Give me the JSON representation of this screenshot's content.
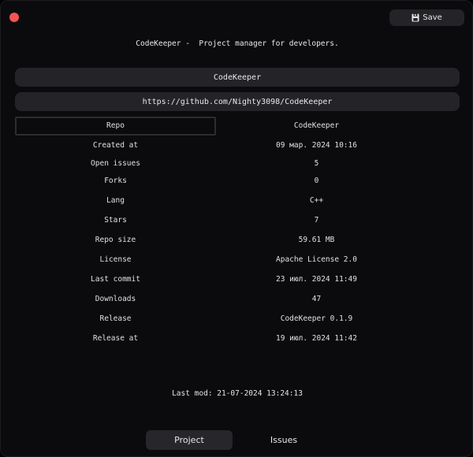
{
  "window": {
    "title": "CodeKeeper -  Project manager for developers.",
    "save_label": "Save"
  },
  "project": {
    "name": "CodeKeeper",
    "url": "https://github.com/Nighty3098/CodeKeeper"
  },
  "table": {
    "rows": [
      {
        "label": "Repo",
        "value": "CodeKeeper"
      },
      {
        "label": "Created at",
        "value": "09 мар. 2024 10:16"
      },
      {
        "label": "Open issues",
        "value": "5"
      },
      {
        "label": "Forks",
        "value": "0"
      },
      {
        "label": "Lang",
        "value": "C++"
      },
      {
        "label": "Stars",
        "value": "7"
      },
      {
        "label": "Repo size",
        "value": "59.61 MB"
      },
      {
        "label": "License",
        "value": "Apache License 2.0"
      },
      {
        "label": "Last commit",
        "value": "23 июл. 2024 11:49"
      },
      {
        "label": "Downloads",
        "value": "47"
      },
      {
        "label": "Release",
        "value": "CodeKeeper 0.1.9"
      },
      {
        "label": "Release at",
        "value": "19 июл. 2024 11:42"
      }
    ]
  },
  "footer": {
    "last_mod": "Last mod: 21-07-2024 13:24:13"
  },
  "tabs": [
    {
      "label": "Project",
      "active": true
    },
    {
      "label": "Issues",
      "active": false
    }
  ],
  "colors": {
    "background": "#0b0b0e",
    "field": "#242428",
    "close": "#f25456",
    "text": "#e6e6e6"
  },
  "icons": {
    "close": "close-icon",
    "save": "save-icon"
  }
}
